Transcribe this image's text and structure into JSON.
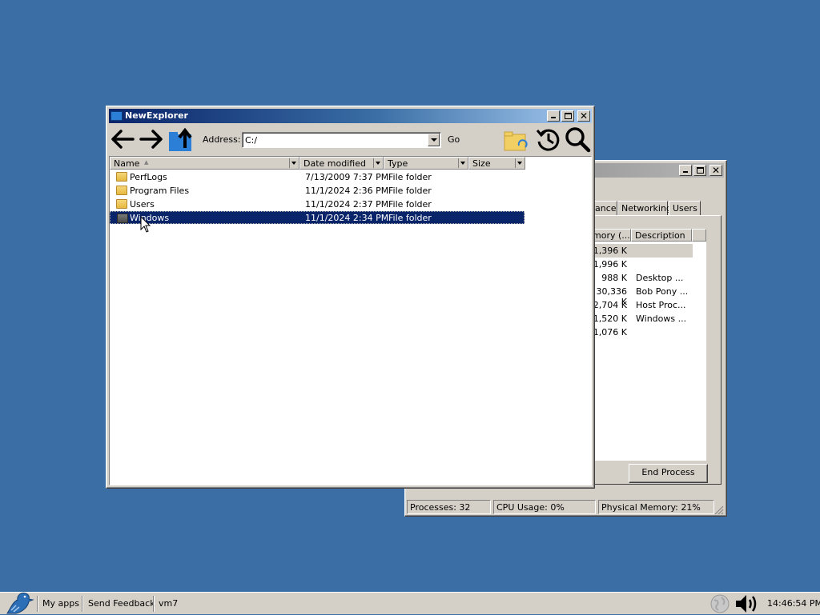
{
  "colors": {
    "desktop": "#3a6ea5",
    "title_active": "#0a246a",
    "selection": "#0a246a",
    "window_face": "#d4d0c8"
  },
  "explorer": {
    "title": "NewExplorer",
    "toolbar": {
      "back_icon": "arrow-left-icon",
      "forward_icon": "arrow-right-icon",
      "up_icon": "folder-up-icon",
      "address_label": "Address:",
      "address_value": "C:/",
      "go_label": "Go",
      "sync_icon": "folder-sync-icon",
      "history_icon": "history-icon",
      "search_icon": "search-icon"
    },
    "columns": {
      "name": "Name",
      "date": "Date modified",
      "type": "Type",
      "size": "Size"
    },
    "rows": [
      {
        "name": "PerfLogs",
        "date": "7/13/2009 7:37 PM",
        "type": "File folder",
        "size": ""
      },
      {
        "name": "Program Files",
        "date": "11/1/2024 2:36 PM",
        "type": "File folder",
        "size": ""
      },
      {
        "name": "Users",
        "date": "11/1/2024 2:37 PM",
        "type": "File folder",
        "size": ""
      },
      {
        "name": "Windows",
        "date": "11/1/2024 2:34 PM",
        "type": "File folder",
        "size": "",
        "selected": true
      }
    ]
  },
  "taskmgr": {
    "tabs": [
      "ance",
      "Networking",
      "Users"
    ],
    "columns": {
      "memory": "mory (...",
      "description": "Description"
    },
    "processes": [
      {
        "memory": "1,396 K",
        "description": ""
      },
      {
        "memory": "1,996 K",
        "description": ""
      },
      {
        "memory": "988 K",
        "description": "Desktop ..."
      },
      {
        "memory": "30,336 K",
        "description": "Bob Pony ..."
      },
      {
        "memory": "2,704 K",
        "description": "Host Proc..."
      },
      {
        "memory": "1,520 K",
        "description": "Windows ..."
      },
      {
        "memory": "1,076 K",
        "description": ""
      }
    ],
    "end_process": "End Process",
    "status": {
      "processes": "Processes: 32",
      "cpu": "CPU Usage: 0%",
      "memory": "Physical Memory: 21%"
    }
  },
  "taskbar": {
    "start_icon": "bird-logo-icon",
    "items": [
      "My apps",
      "Send Feedback",
      "vm7"
    ],
    "tray_network_icon": "network-globe-icon",
    "tray_volume_icon": "volume-icon",
    "clock": "14:46:54 PM"
  }
}
